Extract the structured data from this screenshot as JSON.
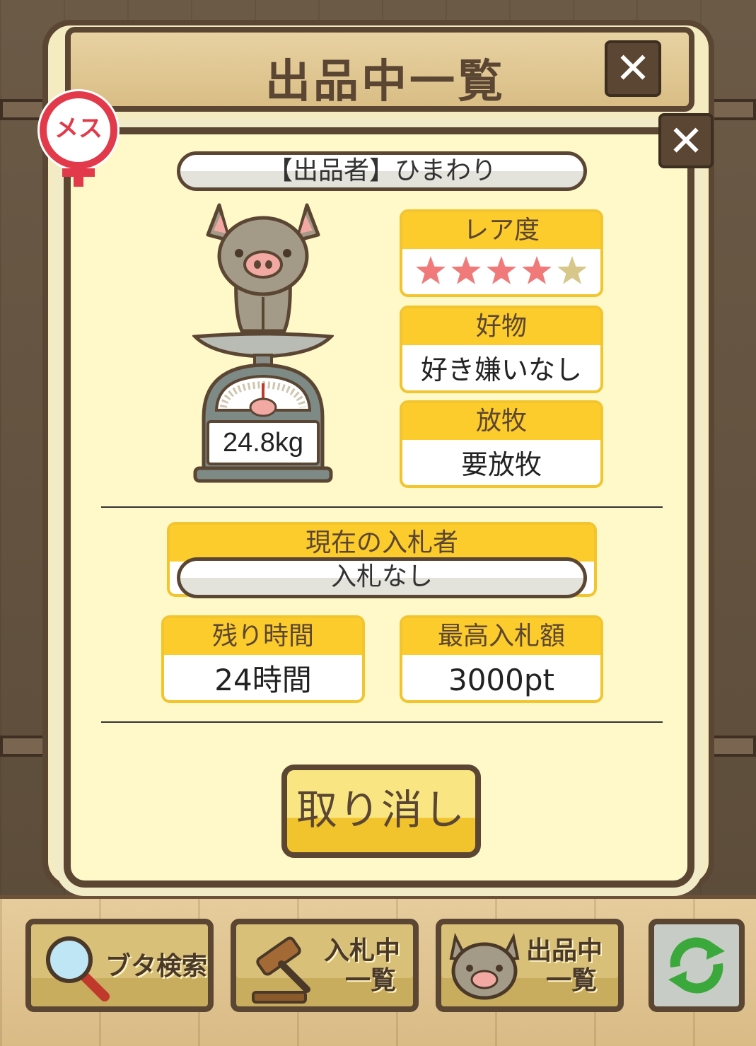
{
  "header": {
    "title": "出品中一覧",
    "close_label": "✕"
  },
  "dialog": {
    "close_label": "✕",
    "gender_badge": "メス",
    "seller_label": "【出品者】ひまわり",
    "weight": "24.8kg",
    "rarity": {
      "label": "レア度",
      "stars_filled": 4,
      "stars_total": 5,
      "star_color_filled": "#f07a7a",
      "star_color_empty": "#d8c78a"
    },
    "favorite": {
      "label": "好物",
      "value": "好き嫌いなし"
    },
    "grazing": {
      "label": "放牧",
      "value": "要放牧"
    },
    "current_bidder": {
      "label": "現在の入札者",
      "value": "入札なし"
    },
    "time_left": {
      "label": "残り時間",
      "value": "24時間"
    },
    "highest_bid": {
      "label": "最高入札額",
      "value": "3000pt"
    },
    "cancel_label": "取り消し"
  },
  "nav": {
    "search_label": "ブタ検索",
    "bidding_line1": "入札中",
    "bidding_line2": "一覧",
    "listing_line1": "出品中",
    "listing_line2": "一覧",
    "refresh_icon": "refresh-icon"
  },
  "colors": {
    "brown": "#5a4632",
    "yellow": "#fccb2c",
    "panel": "#fff8c8",
    "female_red": "#e23a4a",
    "refresh_green": "#3aa83a"
  }
}
